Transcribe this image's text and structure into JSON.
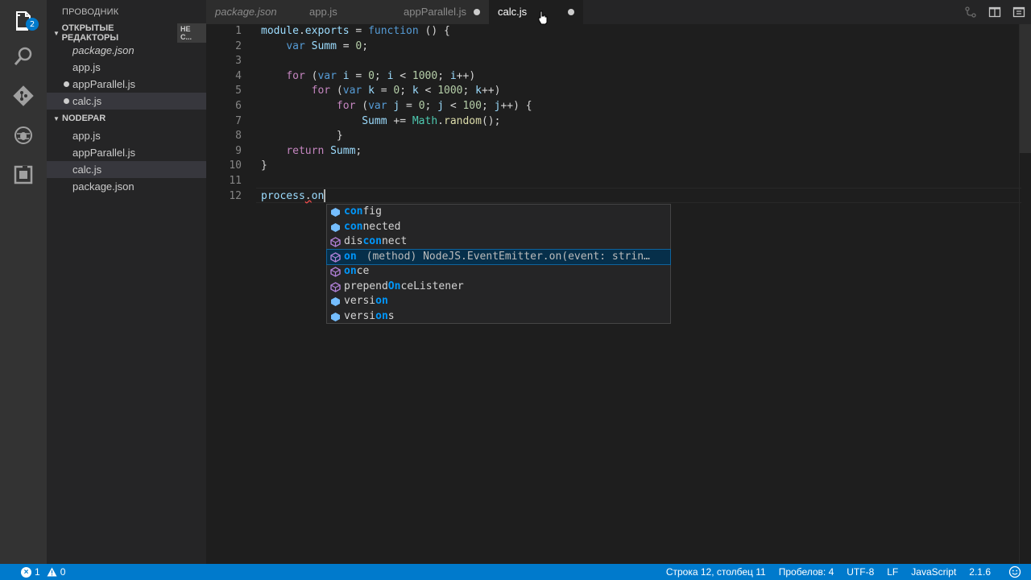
{
  "activity_bar": {
    "badge": "2"
  },
  "sidebar": {
    "title": "ПРОВОДНИК",
    "open_editors": {
      "header": "ОТКРЫТЫЕ РЕДАКТОРЫ",
      "extra": "НЕ С...",
      "files": [
        {
          "name": "package.json",
          "italic": true,
          "dirty": false
        },
        {
          "name": "app.js",
          "italic": false,
          "dirty": false
        },
        {
          "name": "appParallel.js",
          "italic": false,
          "dirty": true
        },
        {
          "name": "calc.js",
          "italic": false,
          "dirty": true,
          "selected": true
        }
      ]
    },
    "project": {
      "header": "NODEPAR",
      "files": [
        {
          "name": "app.js"
        },
        {
          "name": "appParallel.js"
        },
        {
          "name": "calc.js",
          "selected": true
        },
        {
          "name": "package.json"
        }
      ]
    }
  },
  "tabs": [
    {
      "label": "package.json",
      "italic": true
    },
    {
      "label": "app.js"
    },
    {
      "label": "appParallel.js",
      "dirty": true
    },
    {
      "label": "calc.js",
      "active": true,
      "dirty": true
    }
  ],
  "editor": {
    "line_numbers": [
      "1",
      "2",
      "3",
      "4",
      "5",
      "6",
      "7",
      "8",
      "9",
      "10",
      "11",
      "12"
    ],
    "current_line": "12"
  },
  "suggest": {
    "items": [
      {
        "pre": "",
        "match": "con",
        "rest": "fig",
        "kind": "property",
        "detail": ""
      },
      {
        "pre": "",
        "match": "con",
        "rest": "nected",
        "kind": "property",
        "detail": ""
      },
      {
        "pre": "dis",
        "match": "con",
        "rest": "nect",
        "kind": "method",
        "detail": ""
      },
      {
        "pre": "",
        "match": "on",
        "rest": "",
        "kind": "method",
        "detail": "(method) NodeJS.EventEmitter.on(event: strin…",
        "selected": true
      },
      {
        "pre": "",
        "match": "on",
        "rest": "ce",
        "kind": "method",
        "detail": ""
      },
      {
        "pre": "prepend",
        "match": "On",
        "rest": "ceListener",
        "kind": "method",
        "detail": ""
      },
      {
        "pre": "versi",
        "match": "on",
        "rest": "",
        "kind": "property",
        "detail": ""
      },
      {
        "pre": "versi",
        "match": "on",
        "rest": "s",
        "kind": "property",
        "detail": ""
      }
    ]
  },
  "status_bar": {
    "errors": "1",
    "warnings": "0",
    "position": "Строка 12, столбец 11",
    "spaces": "Пробелов: 4",
    "encoding": "UTF-8",
    "eol": "LF",
    "language": "JavaScript",
    "version": "2.1.6"
  },
  "colors": {
    "status_bar": "#007acc",
    "editor_bg": "#1e1e1e",
    "sidebar_bg": "#252526",
    "activity_bg": "#333333"
  }
}
